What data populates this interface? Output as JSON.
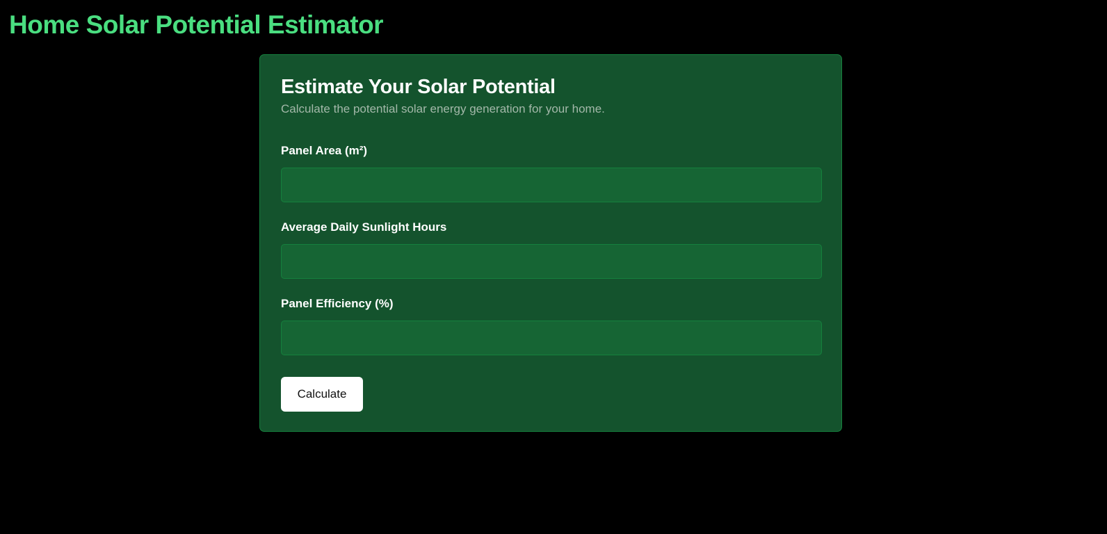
{
  "page": {
    "title": "Home Solar Potential Estimator",
    "accent_color": "#4ade80",
    "card_bg": "#14532d",
    "input_bg": "#166534"
  },
  "card": {
    "title": "Estimate Your Solar Potential",
    "subtitle": "Calculate the potential solar energy generation for your home.",
    "fields": [
      {
        "label": "Panel Area (m²)",
        "value": "",
        "placeholder": ""
      },
      {
        "label": "Average Daily Sunlight Hours",
        "value": "",
        "placeholder": ""
      },
      {
        "label": "Panel Efficiency (%)",
        "value": "",
        "placeholder": ""
      }
    ],
    "button_label": "Calculate"
  }
}
